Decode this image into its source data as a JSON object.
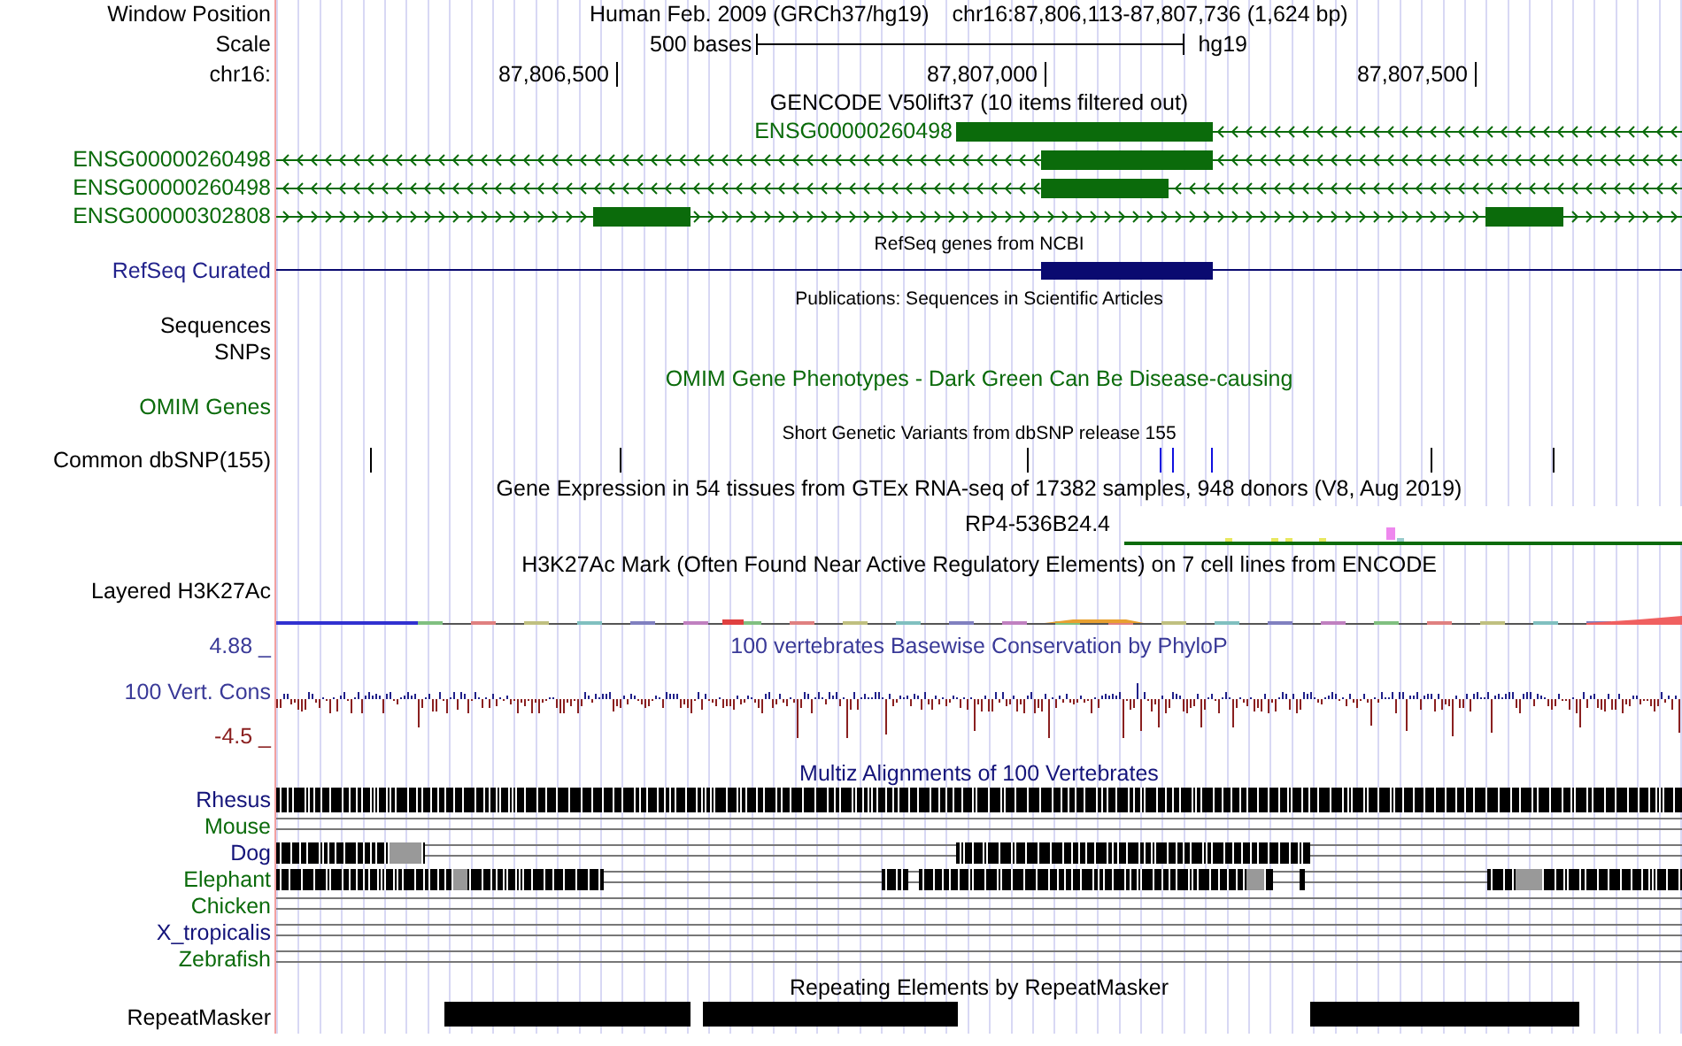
{
  "position": {
    "label": "Window Position",
    "assembly": "Human Feb. 2009 (GRCh37/hg19)",
    "range": "chr16:87,806,113-87,807,736 (1,624 bp)"
  },
  "scale": {
    "label": "Scale",
    "length": "500 bases",
    "database": "hg19"
  },
  "ruler": {
    "label": "chr16:",
    "ticks": [
      "87,806,500",
      "87,807,000",
      "87,807,500"
    ]
  },
  "tracks": [
    {
      "kind": "title",
      "text": "GENCODE V50lift37 (10 items filtered out)",
      "color": "#000000"
    },
    {
      "kind": "gene_inline",
      "name": "ENSG00000260498",
      "color": "#0b6b0b"
    },
    {
      "kind": "gene",
      "name": "ENSG00000260498",
      "color": "#0b6b0b"
    },
    {
      "kind": "gene",
      "name": "ENSG00000260498",
      "color": "#0b6b0b"
    },
    {
      "kind": "gene",
      "name": "ENSG00000302808",
      "color": "#0b6b0b"
    },
    {
      "kind": "small_title",
      "text": "RefSeq genes from NCBI"
    },
    {
      "kind": "refseq",
      "name": "RefSeq Curated",
      "color": "#23238c"
    },
    {
      "kind": "small_title",
      "text": "Publications: Sequences in Scientific Articles"
    },
    {
      "kind": "label",
      "name": "Sequences",
      "color": "#000000"
    },
    {
      "kind": "label",
      "name": "SNPs",
      "color": "#000000"
    },
    {
      "kind": "title",
      "text": "OMIM Gene Phenotypes - Dark Green Can Be Disease-causing",
      "color": "#0b6b0b"
    },
    {
      "kind": "label",
      "name": "OMIM Genes",
      "color": "#0b6b0b"
    },
    {
      "kind": "small_title",
      "text": "Short Genetic Variants from dbSNP release 155"
    },
    {
      "kind": "snp",
      "name": "Common dbSNP(155)",
      "color": "#000000"
    },
    {
      "kind": "title",
      "text": "Gene Expression in 54 tissues from GTEx RNA-seq of 17382 samples, 948 donors (V8, Aug 2019)",
      "color": "#000000"
    },
    {
      "kind": "gtex",
      "gene": "RP4-536B24.4"
    },
    {
      "kind": "title",
      "text": "H3K27Ac Mark (Often Found Near Active Regulatory Elements) on 7 cell lines from ENCODE",
      "color": "#000000"
    },
    {
      "kind": "signal",
      "name": "Layered H3K27Ac",
      "color": "#000000"
    },
    {
      "kind": "phylop",
      "top": "4.88 _",
      "name": "100 Vert. Cons",
      "bottom": "-4.5 _",
      "title": "100 vertebrates Basewise Conservation by PhyloP"
    },
    {
      "kind": "title",
      "text": "Multiz Alignments of 100 Vertebrates",
      "color": "#14147a"
    },
    {
      "kind": "multiz",
      "species": [
        {
          "name": "Rhesus",
          "color": "#14147a"
        },
        {
          "name": "Mouse",
          "color": "#0b6b0b"
        },
        {
          "name": "Dog",
          "color": "#14147a"
        },
        {
          "name": "Elephant",
          "color": "#0b6b0b"
        },
        {
          "name": "Chicken",
          "color": "#0b6b0b"
        },
        {
          "name": "X_tropicalis",
          "color": "#14147a"
        },
        {
          "name": "Zebrafish",
          "color": "#0b6b0b"
        }
      ]
    },
    {
      "kind": "title",
      "text": "Repeating Elements by RepeatMasker",
      "color": "#000000"
    },
    {
      "kind": "repeat",
      "name": "RepeatMasker",
      "color": "#000000"
    }
  ]
}
